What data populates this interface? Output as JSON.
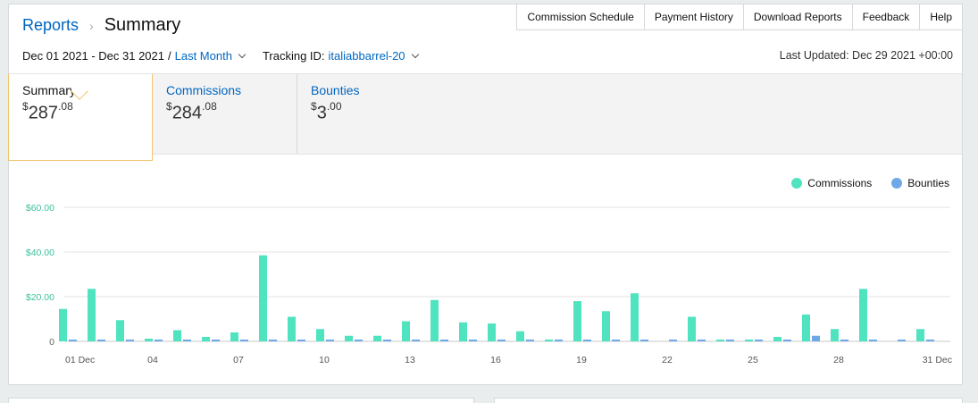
{
  "breadcrumb": {
    "parent": "Reports",
    "current": "Summary"
  },
  "top_nav": [
    "Commission Schedule",
    "Payment History",
    "Download Reports",
    "Feedback",
    "Help"
  ],
  "date_range": {
    "range": "Dec 01 2021 - Dec 31 2021",
    "separator": "/",
    "preset": "Last Month"
  },
  "tracking": {
    "label": "Tracking ID:",
    "value": "italiabbarrel-20"
  },
  "last_updated": "Last Updated: Dec 29 2021 +00:00",
  "tabs": [
    {
      "label": "Summary",
      "currency": "$",
      "whole": "287",
      "cents": ".08"
    },
    {
      "label": "Commissions",
      "currency": "$",
      "whole": "284",
      "cents": ".08"
    },
    {
      "label": "Bounties",
      "currency": "$",
      "whole": "3",
      "cents": ".00"
    }
  ],
  "legend": [
    {
      "name": "Commissions",
      "color": "#4fe3c0"
    },
    {
      "name": "Bounties",
      "color": "#6fa8e6"
    }
  ],
  "chart_data": {
    "type": "bar",
    "categories": [
      "01 Dec",
      "02",
      "03",
      "04",
      "05",
      "06",
      "07",
      "08",
      "09",
      "10",
      "11",
      "12",
      "13",
      "14",
      "15",
      "16",
      "17",
      "18",
      "19",
      "20",
      "21",
      "22",
      "23",
      "24",
      "25",
      "26",
      "27",
      "28",
      "29",
      "30",
      "31 Dec"
    ],
    "x_tick_labels": [
      "01 Dec",
      "04",
      "07",
      "10",
      "13",
      "16",
      "19",
      "22",
      "25",
      "28",
      "31 Dec"
    ],
    "x_tick_indices": [
      0,
      3,
      6,
      9,
      12,
      15,
      18,
      21,
      24,
      27,
      30
    ],
    "y_ticks": [
      0,
      20,
      40,
      60
    ],
    "y_tick_labels": [
      "0",
      "$20.00",
      "$40.00",
      "$60.00"
    ],
    "ylim": [
      0,
      60
    ],
    "series": [
      {
        "name": "Commissions",
        "color": "#4fe3c0",
        "values": [
          14.5,
          23.5,
          9.5,
          1.2,
          5,
          2,
          4,
          38.5,
          11,
          5.5,
          2.5,
          2.5,
          9,
          18.5,
          8.5,
          8,
          4.5,
          0.8,
          18,
          13.5,
          21.5,
          0,
          11,
          0.8,
          0.8,
          2,
          12,
          5.5,
          23.5,
          0,
          5.5
        ]
      },
      {
        "name": "Bounties",
        "color": "#6fa8e6",
        "values": [
          0.8,
          0.8,
          0.8,
          0.8,
          0.8,
          0.8,
          0.8,
          0.8,
          0.8,
          0.8,
          0.8,
          0.8,
          0.8,
          0.8,
          0.8,
          0.8,
          0.8,
          0.8,
          0.8,
          0.8,
          0.8,
          0.8,
          0.8,
          0.8,
          0.8,
          0.8,
          2.5,
          0.8,
          0.8,
          0.8,
          0.8
        ]
      }
    ]
  }
}
